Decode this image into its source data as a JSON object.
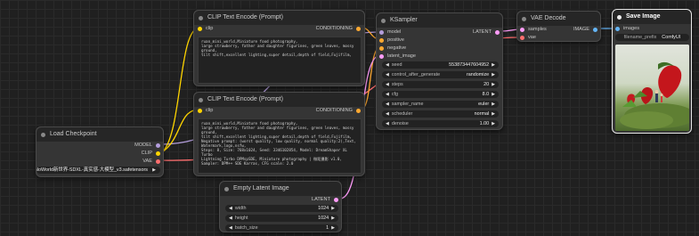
{
  "nodes": {
    "clip_top": {
      "title": "CLIP Text Encode (Prompt)",
      "input_label": "clip",
      "output_label": "CONDITIONING",
      "text": "ruan_mini_world,Miniature food photography,\nlarge strawberry, father and daughter figurines, green leaves, mossy ground,\ntilt shift,excellent lighting,super detail,depth of field,Fujifilm,"
    },
    "clip_bottom": {
      "title": "CLIP Text Encode (Prompt)",
      "input_label": "clip",
      "output_label": "CONDITIONING",
      "text": "ruan_mini_world,Miniature food photography,\nlarge strawberry, father and daughter figurines, green leaves, mossy ground,\ntilt shift,excellent lighting,super detail,depth of field,Fujifilm,\nNegative prompt: (worst quality, low quality, normal quality:2),Text,\nWatermark,logo,nsfw,\nSteps: 8, Size: 768x1024, Seed: 3346102854, Model: DreamShaper XL Turbo\nLightning Turbo DPMspSDE, Miniature photography | 微距摄影 v1.0,\nSampler: DPM++ SDE Karras, CFG scale: 2.0"
    },
    "load_checkpoint": {
      "title": "Load Checkpoint",
      "outputs": [
        "MODEL",
        "CLIP",
        "VAE"
      ],
      "ckpt_name": "EOSAM's HelloWorld新世界-SDXL-真实感-大模型_v3.safetensors"
    },
    "ksampler": {
      "title": "KSampler",
      "inputs": [
        "model",
        "positive",
        "negative",
        "latent_image"
      ],
      "output_label": "LATENT",
      "widgets": [
        {
          "label": "seed",
          "value": "553873447604952"
        },
        {
          "label": "control_after_generate",
          "value": "randomize"
        },
        {
          "label": "steps",
          "value": "20"
        },
        {
          "label": "cfg",
          "value": "8.0"
        },
        {
          "label": "sampler_name",
          "value": "euler"
        },
        {
          "label": "scheduler",
          "value": "normal"
        },
        {
          "label": "denoise",
          "value": "1.00"
        }
      ]
    },
    "vae_decode": {
      "title": "VAE Decode",
      "inputs": [
        "samples",
        "vae"
      ],
      "output_label": "IMAGE"
    },
    "save_image": {
      "title": "Save Image",
      "input_label": "images",
      "prefix_label": "filename_prefix",
      "prefix_value": "ComfyUI"
    },
    "empty_latent": {
      "title": "Empty Latent Image",
      "output_label": "LATENT",
      "widgets": [
        {
          "label": "width",
          "value": "1024"
        },
        {
          "label": "height",
          "value": "1024"
        },
        {
          "label": "batch_size",
          "value": "1"
        }
      ]
    }
  },
  "colors": {
    "model": "#b39ddb",
    "clip": "#ffd500",
    "vae": "#ff6e6e",
    "conditioning": "#ffa931",
    "latent": "#ff9cf9",
    "image": "#64b5f6"
  },
  "icons": {
    "arrow_left": "◀",
    "arrow_right": "▶"
  }
}
